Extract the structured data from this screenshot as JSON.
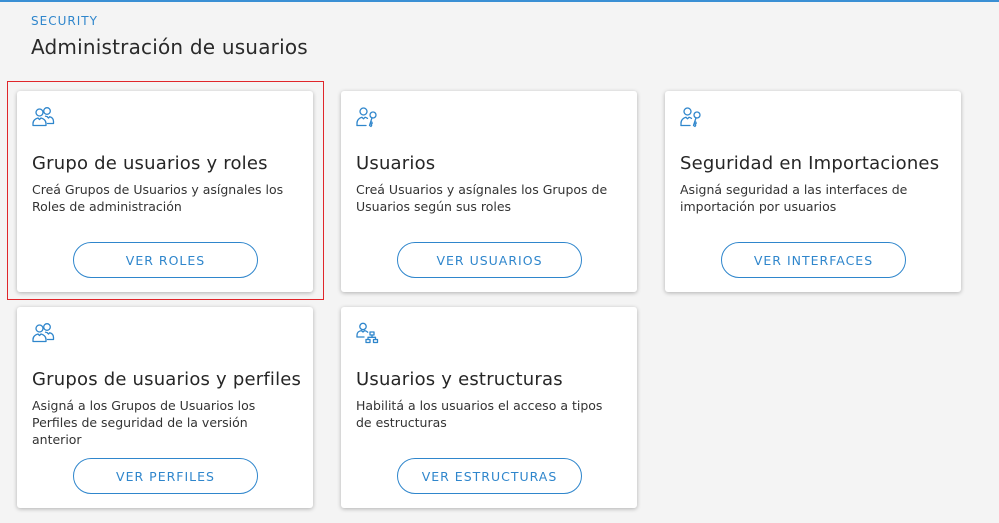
{
  "header": {
    "section_label": "SECURITY",
    "title": "Administración de usuarios"
  },
  "colors": {
    "accent": "#2f86cc",
    "selection": "#e0262b"
  },
  "cards": [
    {
      "icon": "user-group-icon",
      "title": "Grupo de usuarios y roles",
      "description": "Creá Grupos de Usuarios y asígnales los Roles de administración",
      "button": "VER ROLES",
      "selected": true
    },
    {
      "icon": "user-key-icon",
      "title": "Usuarios",
      "description": "Creá Usuarios y asígnales los Grupos de Usuarios según sus roles",
      "button": "VER USUARIOS",
      "selected": false
    },
    {
      "icon": "user-key-icon",
      "title": "Seguridad en Importaciones",
      "description": "Asigná seguridad a las interfaces de importación por usuarios",
      "button": "VER INTERFACES",
      "selected": false
    },
    {
      "icon": "user-group-icon",
      "title": "Grupos de usuarios y perfiles",
      "description": "Asigná a los Grupos de Usuarios los Perfiles de seguridad de la versión anterior",
      "button": "VER PERFILES",
      "selected": false
    },
    {
      "icon": "user-structure-icon",
      "title": "Usuarios y estructuras",
      "description": "Habilitá a los usuarios el acceso a tipos de estructuras",
      "button": "VER ESTRUCTURAS",
      "selected": false
    }
  ]
}
